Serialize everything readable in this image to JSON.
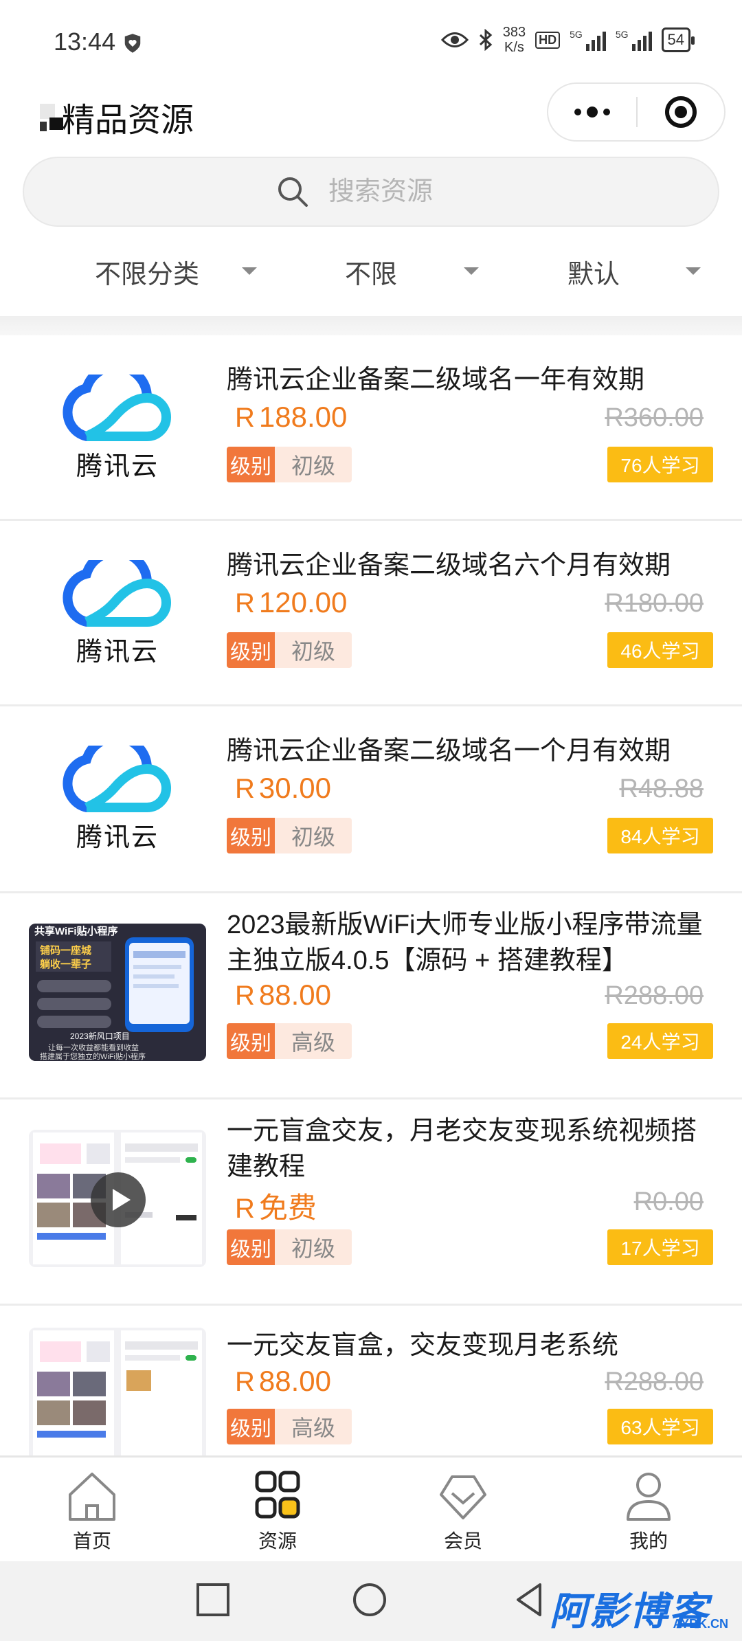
{
  "status_bar": {
    "time": "13:44",
    "speed_value": "383",
    "speed_unit": "K/s",
    "hd": "HD",
    "net1": "5G",
    "net2": "5G",
    "battery": "54"
  },
  "nav": {
    "title": "精品资源"
  },
  "search": {
    "placeholder": "搜索资源"
  },
  "filters": [
    "不限分类",
    "不限",
    "默认"
  ],
  "currency": "R",
  "level_label": "级别",
  "items": [
    {
      "thumb": "腾讯云",
      "title": "腾讯云企业备案二级域名一年有效期",
      "price": "188.00",
      "original": "R360.00",
      "level": "初级",
      "learners": "76人学习"
    },
    {
      "thumb": "腾讯云",
      "title": "腾讯云企业备案二级域名六个月有效期",
      "price": "120.00",
      "original": "R180.00",
      "level": "初级",
      "learners": "46人学习"
    },
    {
      "thumb": "腾讯云",
      "title": "腾讯云企业备案二级域名一个月有效期",
      "price": "30.00",
      "original": "R48.88",
      "level": "初级",
      "learners": "84人学习"
    },
    {
      "thumb_texts": [
        "共享WiFi贴小程序",
        "铺码一座城",
        "躺收一辈子",
        "2023新风口项目",
        "让每一次收益都能看到收益",
        "搭建属于您独立的WiFi贴小程序"
      ],
      "title": "2023最新版WiFi大师专业版小程序带流量主独立版4.0.5【源码 + 搭建教程】",
      "price": "88.00",
      "original": "R288.00",
      "level": "高级",
      "learners": "24人学习"
    },
    {
      "title": "一元盲盒交友，月老交友变现系统视频搭建教程",
      "price": "免费",
      "original": "R0.00",
      "level": "初级",
      "learners": "17人学习"
    },
    {
      "title": "一元交友盲盒，交友变现月老系统",
      "price": "88.00",
      "original": "R288.00",
      "level": "高级",
      "learners": "63人学习"
    }
  ],
  "tabbar": [
    "首页",
    "资源",
    "会员",
    "我的"
  ],
  "tab_active_color": "#f9c21a",
  "price_color": "#f07b1d",
  "watermark": {
    "big": "阿影博客",
    "small": "AYBK.CN"
  }
}
